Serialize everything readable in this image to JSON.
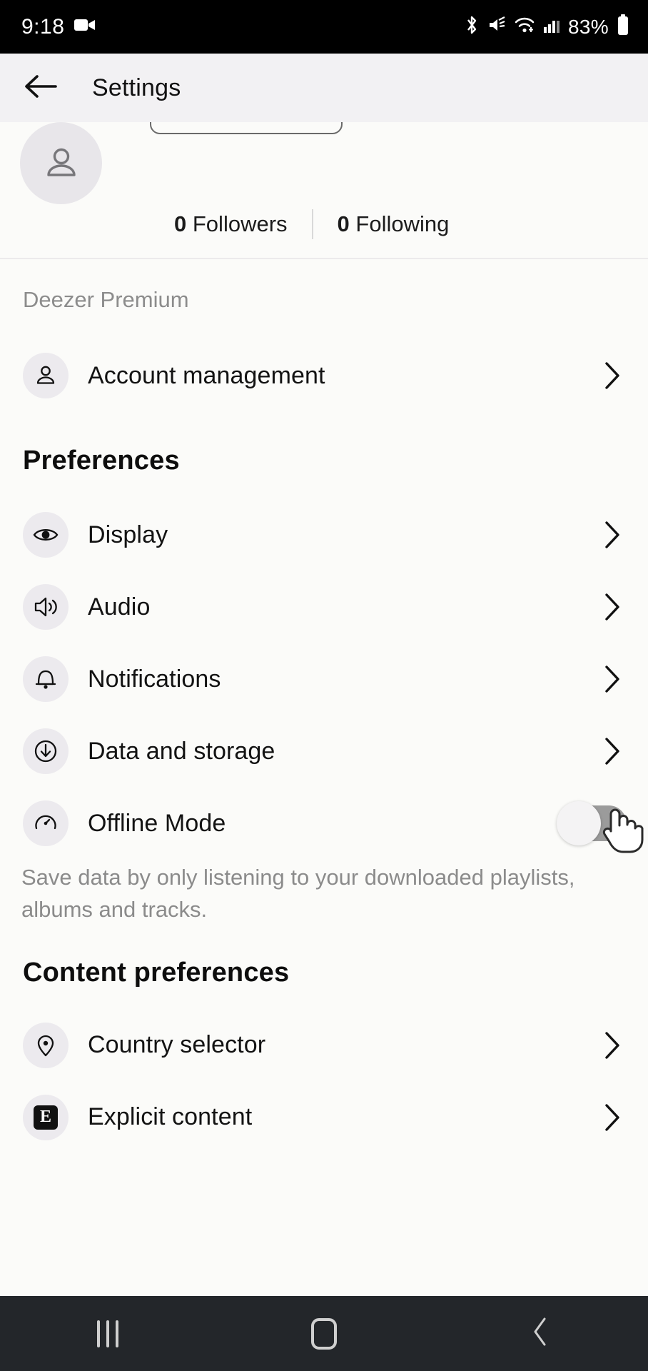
{
  "status_bar": {
    "time": "9:18",
    "battery_percent": "83%",
    "icons": [
      "video-camera-icon",
      "bluetooth-icon",
      "mute-icon",
      "wifi-icon",
      "cellular-signal-icon",
      "battery-icon"
    ]
  },
  "app_bar": {
    "title": "Settings",
    "back_icon": "arrow-left-icon"
  },
  "profile": {
    "avatar_icon": "person-icon",
    "followers_count": "0",
    "followers_label": "Followers",
    "following_count": "0",
    "following_label": "Following"
  },
  "sections": [
    {
      "label": "Deezer Premium",
      "style": "small-gray",
      "rows": [
        {
          "icon": "person-icon",
          "label": "Account management",
          "trailing": "chevron-right-icon"
        }
      ]
    },
    {
      "label": "Preferences",
      "style": "heading",
      "rows": [
        {
          "icon": "eye-icon",
          "label": "Display",
          "trailing": "chevron-right-icon"
        },
        {
          "icon": "speaker-icon",
          "label": "Audio",
          "trailing": "chevron-right-icon"
        },
        {
          "icon": "bell-icon",
          "label": "Notifications",
          "trailing": "chevron-right-icon"
        },
        {
          "icon": "download-circle-icon",
          "label": "Data and storage",
          "trailing": "chevron-right-icon"
        },
        {
          "icon": "offline-gauge-icon",
          "label": "Offline Mode",
          "trailing": "toggle-switch",
          "toggle_state": "off",
          "description": "Save data by only listening to your downloaded playlists, albums and tracks."
        }
      ]
    },
    {
      "label": "Content preferences",
      "style": "heading",
      "rows": [
        {
          "icon": "map-pin-icon",
          "label": "Country selector",
          "trailing": "chevron-right-icon"
        },
        {
          "icon": "explicit-badge-icon",
          "label": "Explicit content",
          "trailing": "chevron-right-icon"
        }
      ]
    }
  ],
  "cursor": {
    "icon": "pointing-hand-cursor"
  },
  "nav_bar": {
    "recents_label": "recent-apps",
    "home_label": "home",
    "back_label": "back"
  },
  "colors": {
    "page_bg": "#fbfbf9",
    "appbar_bg": "#f2f1f3",
    "icon_circle": "#eceaee",
    "muted_text": "#8c8c8c",
    "navbar_bg": "#23262a",
    "toggle_off_track": "#9b9b9b"
  }
}
